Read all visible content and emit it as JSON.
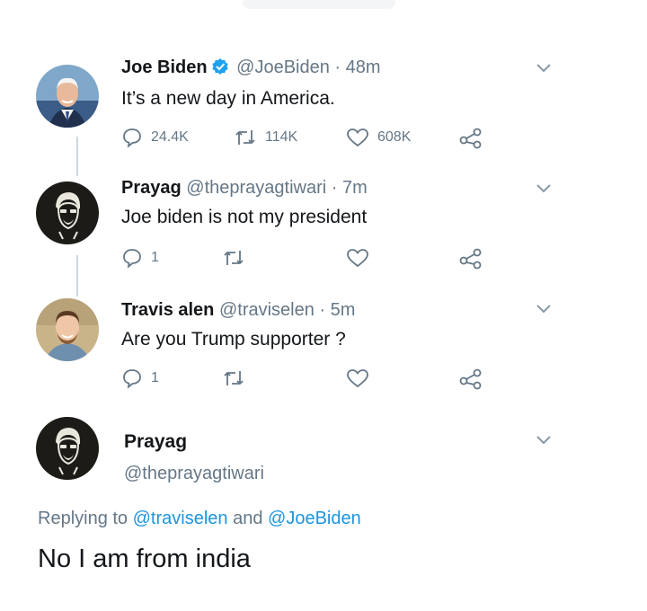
{
  "tweets": [
    {
      "name": "Joe Biden",
      "verified": true,
      "handle": "@JoeBiden",
      "sep": "·",
      "time": "48m",
      "text": "It’s a new day in America.",
      "replies": "24.4K",
      "retweets": "114K",
      "likes": "608K"
    },
    {
      "name": "Prayag",
      "handle": "@theprayagtiwari",
      "sep": "·",
      "time": "7m",
      "text": "Joe biden is not my president",
      "replies": "1",
      "retweets": "",
      "likes": ""
    },
    {
      "name": "Travis alen",
      "handle": "@traviselen",
      "sep": "·",
      "time": "5m",
      "text": "Are you Trump supporter ?",
      "replies": "1",
      "retweets": "",
      "likes": ""
    }
  ],
  "detail": {
    "name": "Prayag",
    "handle": "@theprayagtiwari",
    "replying_prefix": "Replying to",
    "replying_user1": "@traviselen",
    "replying_and": "and",
    "replying_user2": "@JoeBiden",
    "text": "No I am from india"
  },
  "icons": [
    "reply-icon",
    "retweet-icon",
    "like-icon",
    "share-icon",
    "chevron-down-icon",
    "verified-badge-icon"
  ],
  "colors": {
    "text": "#14171a",
    "muted": "#657786",
    "link": "#1b95e0",
    "verified": "#1da1f2",
    "thread_line": "#cfd9de"
  }
}
